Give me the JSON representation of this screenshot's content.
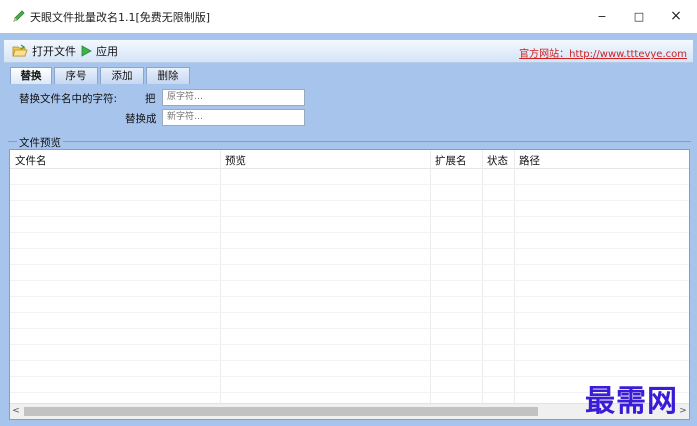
{
  "window": {
    "title": "天眼文件批量改名1.1[免费无限制版]",
    "controls": {
      "minimize": "−",
      "maximize": "□",
      "close": "×"
    }
  },
  "toolbar": {
    "open_label": "打开文件",
    "apply_label": "应用",
    "website": "官方网站：http://www.tttevye.com"
  },
  "tabs": [
    {
      "label": "替换",
      "active": true
    },
    {
      "label": "序号"
    },
    {
      "label": "添加"
    },
    {
      "label": "删除"
    }
  ],
  "replace_form": {
    "section_label": "替换文件名中的字符:",
    "from_label": "把",
    "from_placeholder": "原字符…",
    "to_label": "替换成",
    "to_placeholder": "新字符…"
  },
  "preview": {
    "group_label": "文件预览",
    "columns": [
      "文件名",
      "预览",
      "扩展名",
      "状态",
      "路径"
    ]
  },
  "scrollbar": {
    "left_arrow": "<",
    "right_arrow": ">"
  },
  "watermark": "最需网"
}
